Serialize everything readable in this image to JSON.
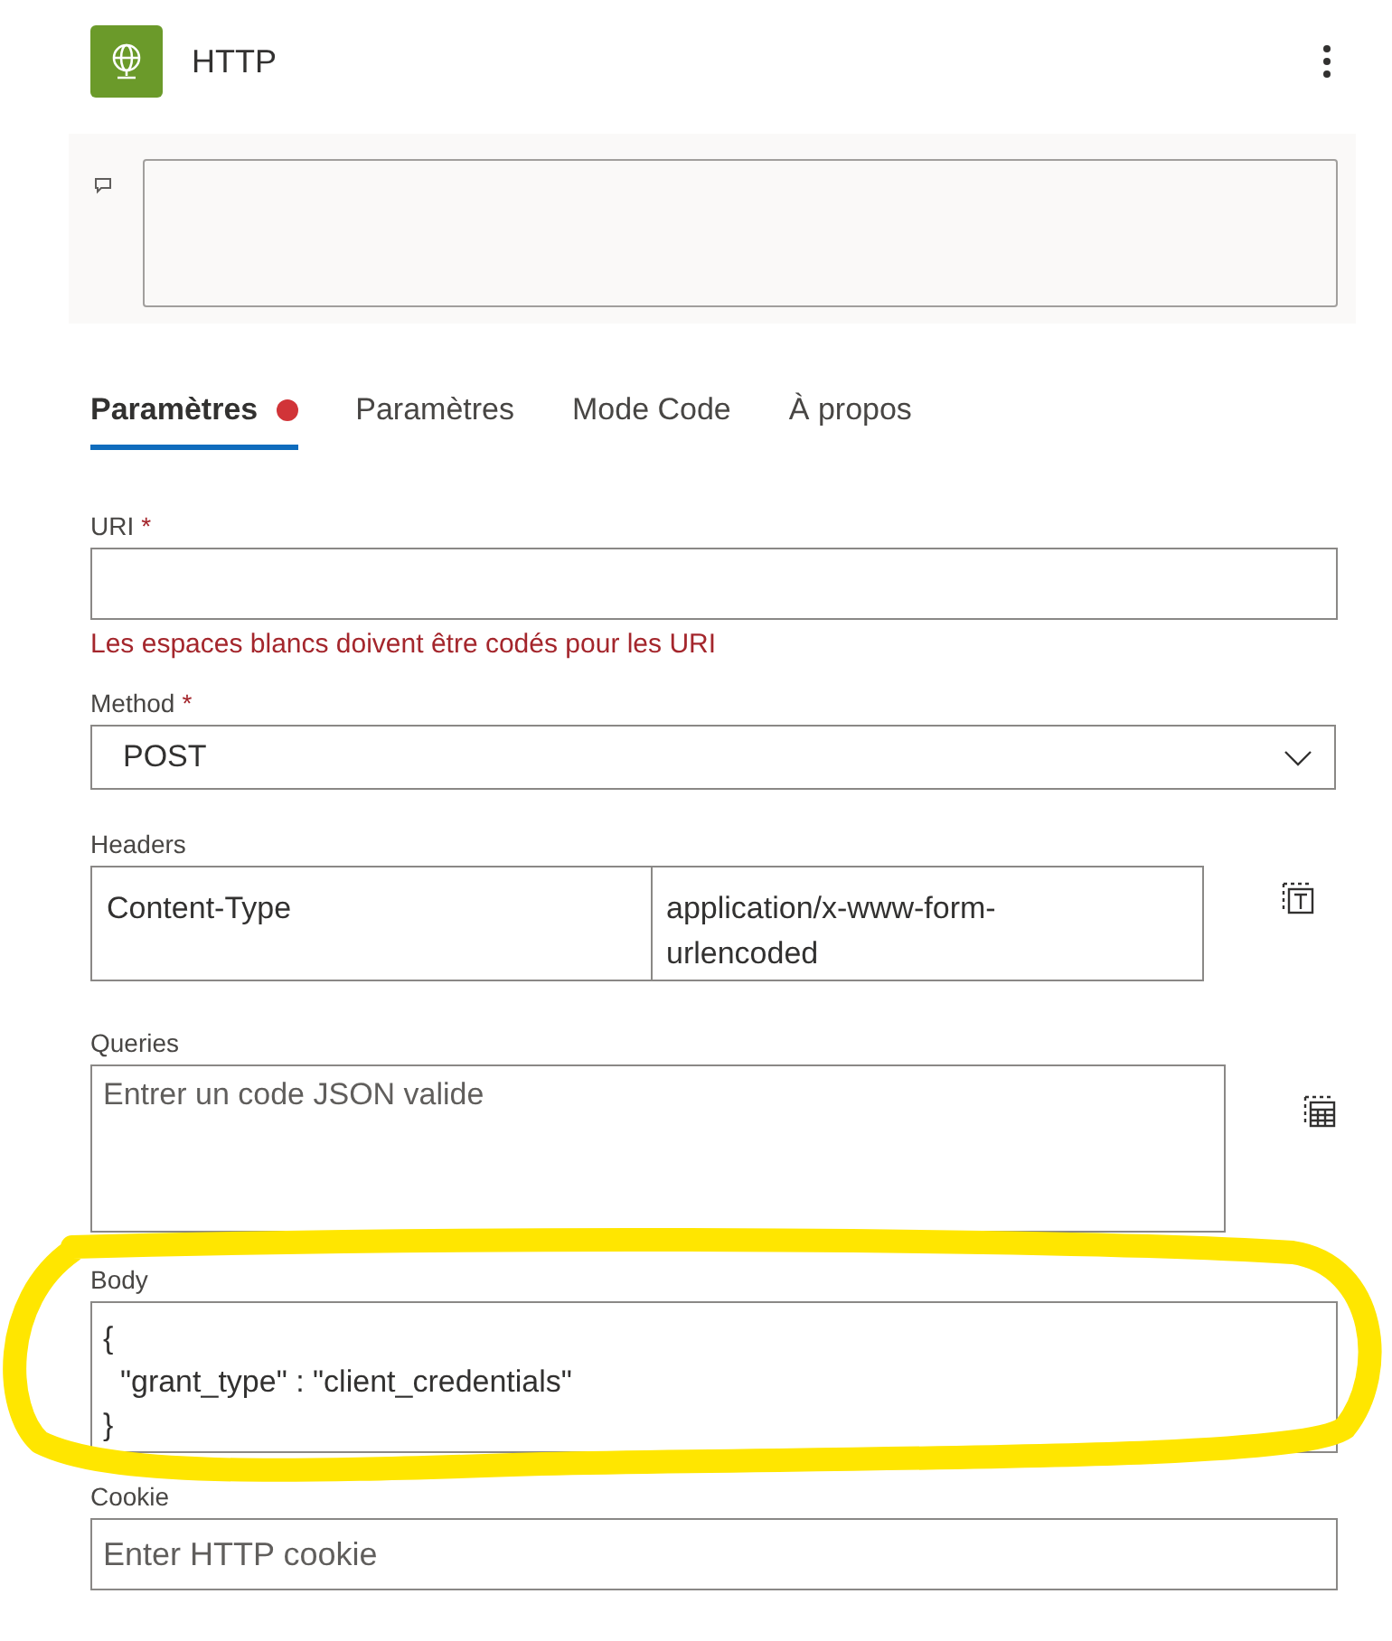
{
  "header": {
    "title": "HTTP"
  },
  "tabs": [
    {
      "label": "Paramètres",
      "selected": true,
      "error": true
    },
    {
      "label": "Paramètres",
      "selected": false,
      "error": false
    },
    {
      "label": "Mode Code",
      "selected": false,
      "error": false
    },
    {
      "label": "À propos",
      "selected": false,
      "error": false
    }
  ],
  "uri": {
    "label": "URI",
    "required_mark": "*",
    "error": "Les espaces blancs doivent être codés pour les URI"
  },
  "method": {
    "label": "Method",
    "required_mark": "*",
    "value": "POST"
  },
  "headers": {
    "label": "Headers",
    "rows": [
      {
        "key": "Content-Type",
        "value": "application/x-www-form-urlencoded"
      }
    ]
  },
  "queries": {
    "label": "Queries",
    "placeholder": "Entrer un code JSON valide"
  },
  "body": {
    "label": "Body",
    "value": "{\n  \"grant_type\" : \"client_credentials\"\n}"
  },
  "cookie": {
    "label": "Cookie",
    "placeholder": "Enter HTTP cookie"
  }
}
